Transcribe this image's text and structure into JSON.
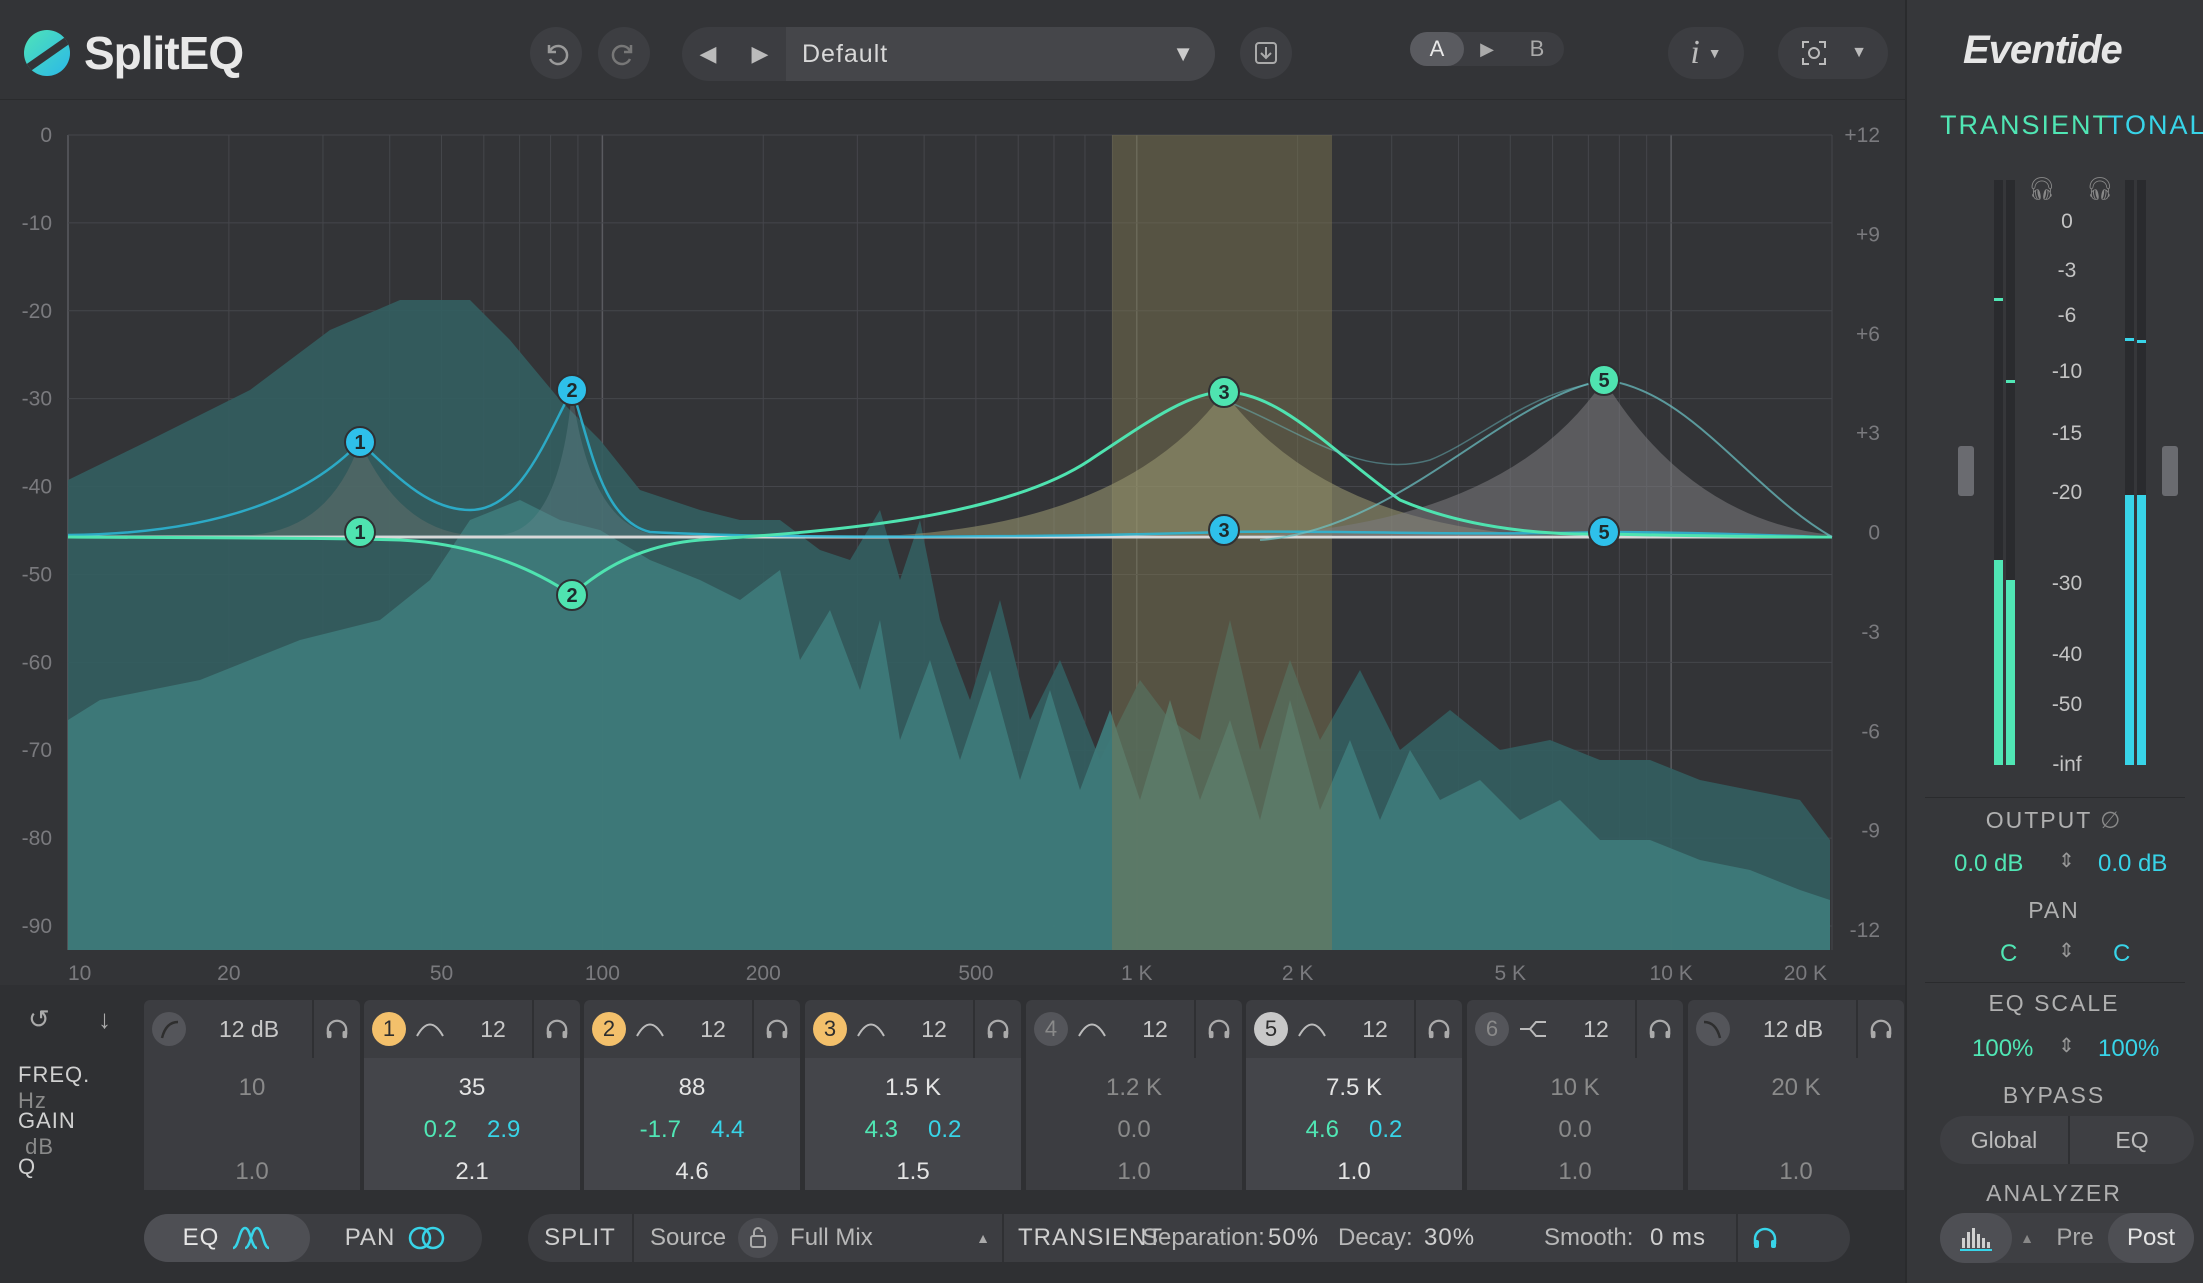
{
  "app": {
    "name": "SplitEQ",
    "brand": "Eventide"
  },
  "toolbar": {
    "undo_icon": "undo-icon",
    "redo_icon": "redo-icon",
    "preset_name": "Default",
    "ab_a": "A",
    "ab_b": "B",
    "info_label": "i"
  },
  "graph": {
    "left_scale": [
      "0",
      "-10",
      "-20",
      "-30",
      "-40",
      "-50",
      "-60",
      "-70",
      "-80",
      "-90"
    ],
    "right_scale": [
      "+12",
      "+9",
      "+6",
      "+3",
      "0",
      "-3",
      "-6",
      "-9",
      "-12"
    ],
    "freq_labels": [
      "10",
      "20",
      "50",
      "100",
      "200",
      "500",
      "1 K",
      "2 K",
      "5 K",
      "10 K",
      "20 K"
    ],
    "highlight_range_hz": [
      900,
      2500
    ],
    "node_labels": [
      "1",
      "2",
      "3",
      "5"
    ],
    "colors": {
      "tonal": "#2ec0ea",
      "transient": "#4fe3b0",
      "highlight": "#6e6a4c"
    }
  },
  "right_panel": {
    "transient_label": "TRANSIENT",
    "tonal_label": "TONAL",
    "meter_scale": [
      "0",
      "-3",
      "-6",
      "-10",
      "-15",
      "-20",
      "-30",
      "-40",
      "-50",
      "-inf"
    ],
    "meter_levels": {
      "transient": 0.37,
      "tonal": 0.46
    },
    "output_title": "OUTPUT",
    "output_transient": "0.0 dB",
    "output_tonal": "0.0 dB",
    "pan_title": "PAN",
    "pan_transient": "C",
    "pan_tonal": "C",
    "eqscale_title": "EQ SCALE",
    "eqscale_transient": "100%",
    "eqscale_tonal": "100%",
    "bypass_title": "BYPASS",
    "bypass_global": "Global",
    "bypass_eq": "EQ",
    "analyzer_title": "ANALYZER",
    "analyzer_pre": "Pre",
    "analyzer_post": "Post"
  },
  "bands": {
    "row_labels": {
      "freq": "FREQ.",
      "freq_unit": "Hz",
      "gain": "GAIN",
      "gain_unit": "dB",
      "q": "Q"
    },
    "items": [
      {
        "num": "",
        "slope": "12 dB",
        "freq": "10",
        "gain_a": "",
        "gain_b": "",
        "q": "1.0",
        "active": false
      },
      {
        "num": "1",
        "slope": "12",
        "freq": "35",
        "gain_a": "0.2",
        "gain_b": "2.9",
        "q": "2.1",
        "active": true,
        "color": "#f3c06b"
      },
      {
        "num": "2",
        "slope": "12",
        "freq": "88",
        "gain_a": "-1.7",
        "gain_b": "4.4",
        "q": "4.6",
        "active": true,
        "color": "#f3c06b"
      },
      {
        "num": "3",
        "slope": "12",
        "freq": "1.5 K",
        "gain_a": "4.3",
        "gain_b": "0.2",
        "q": "1.5",
        "active": true,
        "color": "#f3c06b"
      },
      {
        "num": "4",
        "slope": "12",
        "freq": "1.2 K",
        "gain_a": "0.0",
        "gain_b": "",
        "q": "1.0",
        "active": false
      },
      {
        "num": "5",
        "slope": "12",
        "freq": "7.5 K",
        "gain_a": "4.6",
        "gain_b": "0.2",
        "q": "1.0",
        "active": true,
        "color": "#c8c8c8"
      },
      {
        "num": "6",
        "slope": "12",
        "freq": "10 K",
        "gain_a": "0.0",
        "gain_b": "",
        "q": "1.0",
        "active": false
      },
      {
        "num": "",
        "slope": "12 dB",
        "freq": "20 K",
        "gain_a": "",
        "gain_b": "",
        "q": "1.0",
        "active": false
      }
    ]
  },
  "bottom": {
    "eq_label": "EQ",
    "pan_label": "PAN",
    "split_label": "SPLIT",
    "source_label": "Source",
    "source_value": "Full Mix",
    "transient_label": "TRANSIENT",
    "separation_label": "Separation:",
    "separation_value": "50%",
    "decay_label": "Decay:",
    "decay_value": "30%",
    "smooth_label": "Smooth:",
    "smooth_value": "0 ms"
  }
}
